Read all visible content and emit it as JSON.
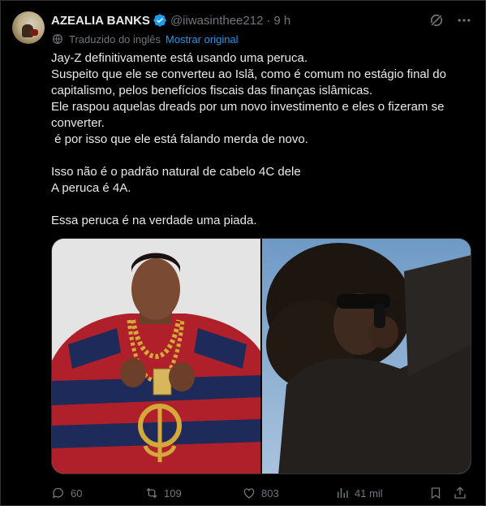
{
  "author": {
    "name": "AZEALIA BANKS",
    "handle": "@iiwasinthee212",
    "separator": "·",
    "time": "9 h"
  },
  "translation": {
    "label": "Traduzido do inglês",
    "show_original": "Mostrar original"
  },
  "tweet": {
    "paragraphs": [
      "Jay-Z definitivamente está usando uma peruca.\nSuspeito que ele se converteu ao Islã, como é comum no estágio final do capitalismo, pelos benefícios fiscais das finanças islâmicas.\nEle raspou aquelas dreads por um novo investimento e eles o fizeram se converter.\n é por isso que ele está falando merda de novo.",
      "Isso não é o padrão natural de cabelo 4C dele\nA peruca é 4A.",
      "Essa peruca é na verdade uma piada."
    ]
  },
  "stats": {
    "replies": "60",
    "reposts": "109",
    "likes": "803",
    "views": "41 mil"
  },
  "colors": {
    "background": "#000000",
    "text": "#e7e9ea",
    "muted": "#71767b",
    "accent": "#1d9bf0"
  }
}
